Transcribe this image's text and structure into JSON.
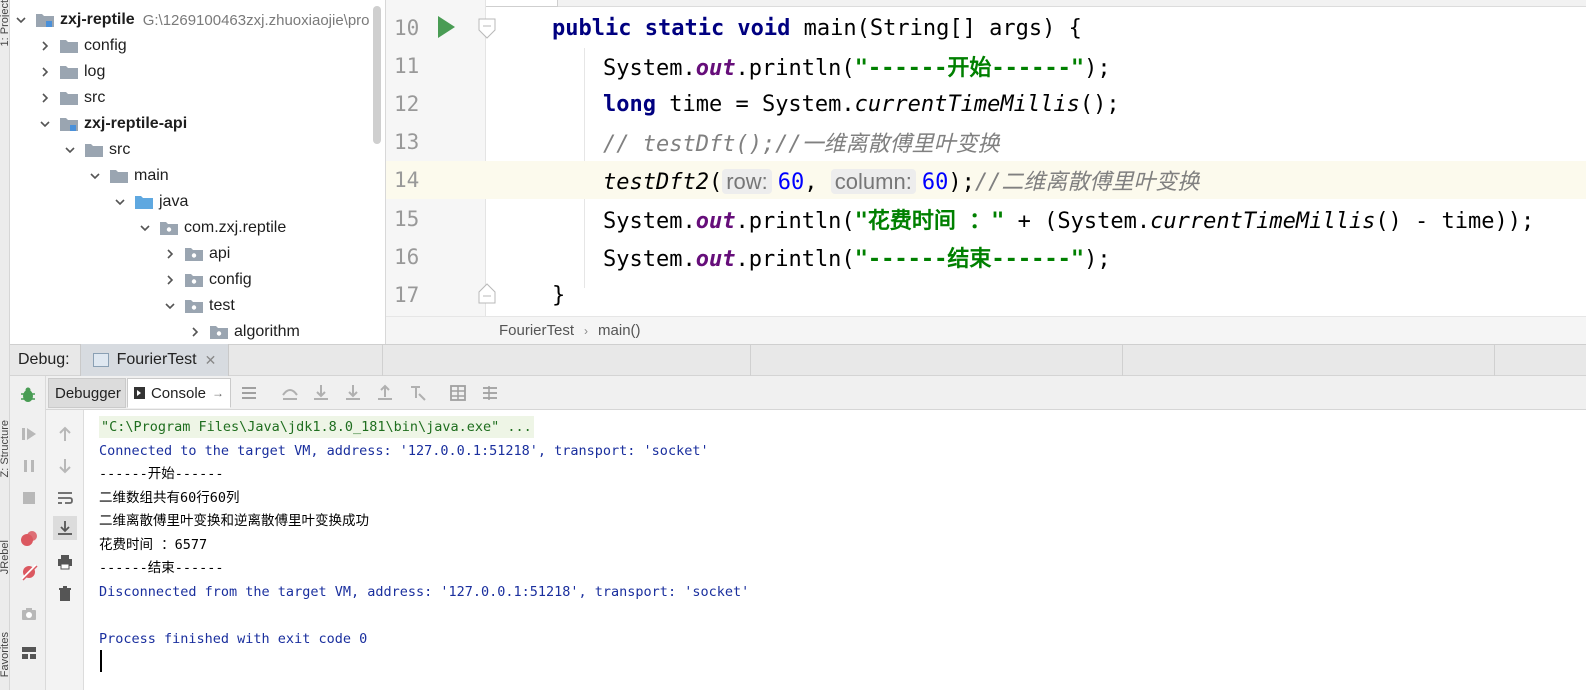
{
  "left_strip": {
    "labels": [
      "1: Project",
      "Z: Structure",
      "JRebel",
      "Favorites"
    ]
  },
  "project_tree": {
    "items": [
      {
        "label": "zxj-reptile",
        "path": "G:\\1269100463zxj.zhuoxiaojie\\pro",
        "bold": true
      },
      {
        "label": "config"
      },
      {
        "label": "log"
      },
      {
        "label": "src"
      },
      {
        "label": "zxj-reptile-api",
        "bold": true
      },
      {
        "label": "src"
      },
      {
        "label": "main"
      },
      {
        "label": "java"
      },
      {
        "label": "com.zxj.reptile"
      },
      {
        "label": "api"
      },
      {
        "label": "config"
      },
      {
        "label": "test"
      },
      {
        "label": "algorithm"
      }
    ]
  },
  "editor": {
    "lines": [
      {
        "num": "10",
        "current": false
      },
      {
        "num": "11",
        "current": false
      },
      {
        "num": "12",
        "current": false
      },
      {
        "num": "13",
        "current": false
      },
      {
        "num": "14",
        "current": true
      },
      {
        "num": "15",
        "current": false
      },
      {
        "num": "16",
        "current": false
      },
      {
        "num": "17",
        "current": false
      }
    ],
    "code": {
      "l10_kw": "public static void",
      "l10_rest": " main(String[] args) {",
      "sys": "System.",
      "out": "out",
      "println_open": ".println(",
      "l11_str": "\"------开始------\"",
      "close_semi": ");",
      "l12_kw": "long",
      "l12_mid": " time = System.",
      "l12_method": "currentTimeMillis",
      "l12_end": "();",
      "l13_comment": "// testDft();//一维离散傅里叶变换",
      "l14_method": "testDft2",
      "l14_open": "(",
      "hint_row": "row:",
      "val_row": "60",
      "comma": ", ",
      "hint_col": "column:",
      "val_col": "60",
      "l14_close": ");",
      "l14_comment": "//二维离散傅里叶变换",
      "l15_str": "\"花费时间 ：\"",
      "l15_mid": " + (System.",
      "l15_method": "currentTimeMillis",
      "l15_end": "() - time));",
      "l16_str": "\"------结束------\"",
      "l17": "}"
    }
  },
  "breadcrumb": {
    "items": [
      "FourierTest",
      "main()"
    ]
  },
  "debug": {
    "title": "Debug:",
    "tab_label": "FourierTest",
    "tabs": {
      "debugger": "Debugger",
      "console": "Console"
    }
  },
  "console": {
    "lines": [
      {
        "text": "\"C:\\Program Files\\Java\\jdk1.8.0_181\\bin\\java.exe\" ...",
        "kind": "cmd"
      },
      {
        "text": "Connected to the target VM, address: '127.0.0.1:51218', transport: 'socket'",
        "kind": "sys"
      },
      {
        "text": "------开始------",
        "kind": "out"
      },
      {
        "text": "二维数组共有60行60列",
        "kind": "out"
      },
      {
        "text": "二维离散傅里叶变换和逆离散傅里叶变换成功",
        "kind": "out"
      },
      {
        "text": "花费时间 ：6577",
        "kind": "out"
      },
      {
        "text": "------结束------",
        "kind": "out"
      },
      {
        "text": "Disconnected from the target VM, address: '127.0.0.1:51218', transport: 'socket'",
        "kind": "sys"
      },
      {
        "text": "",
        "kind": "out"
      },
      {
        "text": "Process finished with exit code 0",
        "kind": "sys"
      }
    ]
  },
  "colors": {
    "keyword": "#000080",
    "string": "#008000",
    "field": "#660e7a",
    "number": "#0000ff",
    "comment": "#808080",
    "console_sys": "#1a2f9e",
    "run_green": "#499c54"
  }
}
